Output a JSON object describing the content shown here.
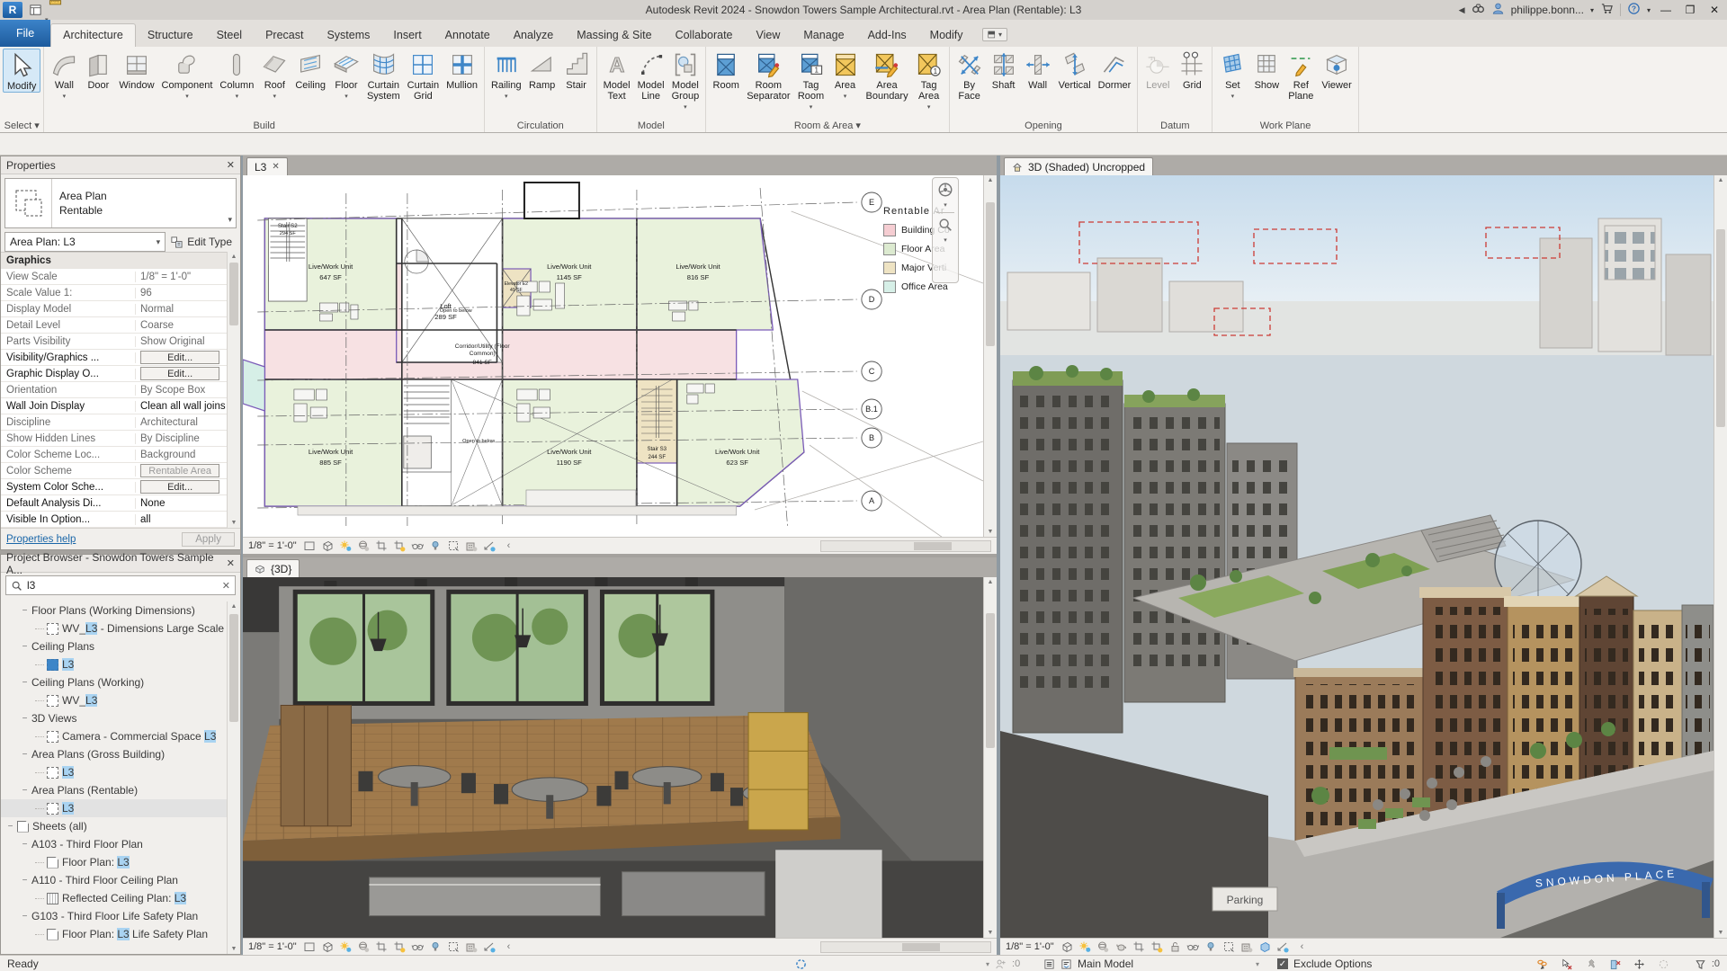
{
  "titlebar": {
    "title": "Autodesk Revit 2024 - Snowdon Towers Sample Architectural.rvt - Area Plan (Rentable): L3",
    "user": "philippe.bonn..."
  },
  "qat": [
    {
      "icon": "new-doc"
    },
    {
      "icon": "open-folder"
    },
    {
      "icon": "save"
    },
    {
      "icon": "sync",
      "arrow": true
    },
    {
      "icon": "undo",
      "arrow": true
    },
    {
      "icon": "redo",
      "arrow": true
    },
    {
      "icon": "print"
    },
    {
      "icon": "print-setup"
    },
    {
      "sep": true
    },
    {
      "icon": "modify-pin"
    },
    {
      "icon": "measure",
      "arrow": true
    },
    {
      "icon": "aligned-dimension"
    },
    {
      "icon": "tag-by-category"
    },
    {
      "icon": "text"
    },
    {
      "sep": true
    },
    {
      "icon": "default-3d-view",
      "arrow": true
    },
    {
      "icon": "view-marker"
    },
    {
      "icon": "thin-lines"
    },
    {
      "sep": true
    },
    {
      "icon": "copy"
    },
    {
      "icon": "switch-windows",
      "arrow": true
    },
    {
      "icon": "customize-qat"
    }
  ],
  "tabs": {
    "items": [
      "File",
      "Architecture",
      "Structure",
      "Steel",
      "Precast",
      "Systems",
      "Insert",
      "Annotate",
      "Analyze",
      "Massing & Site",
      "Collaborate",
      "View",
      "Manage",
      "Add-Ins",
      "Modify"
    ],
    "active": "Architecture"
  },
  "ribbon": {
    "panels": [
      {
        "label": "Select ▾",
        "buttons": [
          {
            "label": "Modify",
            "icon": "modify",
            "selected": true
          }
        ]
      },
      {
        "label": "Build",
        "buttons": [
          {
            "label": "Wall",
            "icon": "wall",
            "arrow": true
          },
          {
            "label": "Door",
            "icon": "door"
          },
          {
            "label": "Window",
            "icon": "window"
          },
          {
            "label": "Component",
            "icon": "component",
            "arrow": true
          },
          {
            "label": "Column",
            "icon": "column",
            "arrow": true
          },
          {
            "label": "Roof",
            "icon": "roof",
            "arrow": true
          },
          {
            "label": "Ceiling",
            "icon": "ceiling"
          },
          {
            "label": "Floor",
            "icon": "floor",
            "arrow": true
          },
          {
            "label": "Curtain\nSystem",
            "icon": "curtain-system"
          },
          {
            "label": "Curtain\nGrid",
            "icon": "curtain-grid"
          },
          {
            "label": "Mullion",
            "icon": "mullion"
          }
        ]
      },
      {
        "label": "Circulation",
        "buttons": [
          {
            "label": "Railing",
            "icon": "railing",
            "arrow": true
          },
          {
            "label": "Ramp",
            "icon": "ramp"
          },
          {
            "label": "Stair",
            "icon": "stair"
          }
        ]
      },
      {
        "label": "Model",
        "buttons": [
          {
            "label": "Model\nText",
            "icon": "model-text"
          },
          {
            "label": "Model\nLine",
            "icon": "model-line"
          },
          {
            "label": "Model\nGroup",
            "icon": "model-group",
            "arrow": true
          }
        ]
      },
      {
        "label": "Room & Area ▾",
        "buttons": [
          {
            "label": "Room",
            "icon": "room"
          },
          {
            "label": "Room\nSeparator",
            "icon": "room-separator"
          },
          {
            "label": "Tag\nRoom",
            "icon": "tag-room",
            "arrow": true
          },
          {
            "label": "Area",
            "icon": "area",
            "arrow": true
          },
          {
            "label": "Area\nBoundary",
            "icon": "area-boundary"
          },
          {
            "label": "Tag\nArea",
            "icon": "tag-area",
            "arrow": true
          }
        ]
      },
      {
        "label": "Opening",
        "buttons": [
          {
            "label": "By\nFace",
            "icon": "by-face"
          },
          {
            "label": "Shaft",
            "icon": "shaft"
          },
          {
            "label": "Wall",
            "icon": "wall-opening"
          },
          {
            "label": "Vertical",
            "icon": "vertical-opening"
          },
          {
            "label": "Dormer",
            "icon": "dormer"
          }
        ]
      },
      {
        "label": "Datum",
        "buttons": [
          {
            "label": "Level",
            "icon": "level",
            "disabled": true
          },
          {
            "label": "Grid",
            "icon": "grid"
          }
        ]
      },
      {
        "label": "Work Plane",
        "buttons": [
          {
            "label": "Set",
            "icon": "set",
            "arrow": true
          },
          {
            "label": "Show",
            "icon": "show"
          },
          {
            "label": "Ref\nPlane",
            "icon": "ref-plane"
          },
          {
            "label": "Viewer",
            "icon": "viewer"
          }
        ]
      }
    ]
  },
  "properties": {
    "header": "Properties",
    "type_name": "Area Plan",
    "type_family": "Rentable",
    "selector": "Area Plan: L3",
    "edit_type": "Edit Type",
    "group": "Graphics",
    "rows": [
      {
        "name": "View Scale",
        "value": "1/8\" = 1'-0\""
      },
      {
        "name": "Scale Value    1:",
        "value": "96"
      },
      {
        "name": "Display Model",
        "value": "Normal"
      },
      {
        "name": "Detail Level",
        "value": "Coarse"
      },
      {
        "name": "Parts Visibility",
        "value": "Show Original"
      },
      {
        "name": "Visibility/Graphics ...",
        "value": "Edit...",
        "button": true,
        "editable": true
      },
      {
        "name": "Graphic Display O...",
        "value": "Edit...",
        "button": true,
        "editable": true
      },
      {
        "name": "Orientation",
        "value": "By Scope Box"
      },
      {
        "name": "Wall Join Display",
        "value": "Clean all wall joins",
        "editable": true
      },
      {
        "name": "Discipline",
        "value": "Architectural"
      },
      {
        "name": "Show Hidden Lines",
        "value": "By Discipline"
      },
      {
        "name": "Color Scheme Loc...",
        "value": "Background"
      },
      {
        "name": "Color Scheme",
        "value": "Rentable Area",
        "button": true,
        "gray": true
      },
      {
        "name": "System Color Sche...",
        "value": "Edit...",
        "button": true,
        "editable": true
      },
      {
        "name": "Default Analysis Di...",
        "value": "None",
        "editable": true
      },
      {
        "name": "Visible In Option...",
        "value": "all",
        "editable": true
      }
    ],
    "help": "Properties help",
    "apply": "Apply"
  },
  "browser": {
    "title": "Project Browser - Snowdon Towers Sample A...",
    "search": "l3",
    "items": [
      {
        "t": "cat",
        "d": 1,
        "label": "Floor Plans (Working Dimensions)"
      },
      {
        "t": "view",
        "d": 2,
        "icon": "plan",
        "pre": "WV_",
        "hl": "L3",
        "post": " - Dimensions Large Scale"
      },
      {
        "t": "cat",
        "d": 1,
        "label": "Ceiling Plans"
      },
      {
        "t": "view",
        "d": 2,
        "icon": "planblue",
        "pre": "",
        "hl": "L3",
        "post": ""
      },
      {
        "t": "cat",
        "d": 1,
        "label": "Ceiling Plans (Working)"
      },
      {
        "t": "view",
        "d": 2,
        "icon": "plan",
        "pre": "WV_",
        "hl": "L3",
        "post": ""
      },
      {
        "t": "cat",
        "d": 1,
        "label": "3D Views"
      },
      {
        "t": "view",
        "d": 2,
        "icon": "plan",
        "pre": "Camera - Commercial Space ",
        "hl": "L3",
        "post": ""
      },
      {
        "t": "cat",
        "d": 1,
        "label": "Area Plans (Gross Building)"
      },
      {
        "t": "view",
        "d": 2,
        "icon": "plan",
        "pre": "",
        "hl": "L3",
        "post": ""
      },
      {
        "t": "cat",
        "d": 1,
        "label": "Area Plans (Rentable)"
      },
      {
        "t": "view",
        "d": 2,
        "icon": "plan",
        "pre": "",
        "hl": "L3",
        "post": "",
        "selected": true
      },
      {
        "t": "cat",
        "d": 0,
        "icon": "sheet",
        "label": "Sheets (all)"
      },
      {
        "t": "cat",
        "d": 1,
        "label": "A103 - Third Floor Plan"
      },
      {
        "t": "view",
        "d": 2,
        "icon": "sheet",
        "pre": "Floor Plan: ",
        "hl": "L3",
        "post": ""
      },
      {
        "t": "cat",
        "d": 1,
        "label": "A110 - Third Floor Ceiling Plan"
      },
      {
        "t": "view",
        "d": 2,
        "icon": "rcp",
        "pre": "Reflected Ceiling Plan: ",
        "hl": "L3",
        "post": ""
      },
      {
        "t": "cat",
        "d": 1,
        "label": "G103 - Third Floor Life Safety Plan"
      },
      {
        "t": "view",
        "d": 2,
        "icon": "sheet",
        "pre": "Floor Plan: ",
        "hl": "L3",
        "post": " Life Safety Plan"
      }
    ]
  },
  "plan": {
    "tab": "L3",
    "scale": "1/8\" = 1'-0\"",
    "legend_title": "Rentable Ar",
    "legend": [
      {
        "label": "Building Co",
        "color": "#f5cdd2"
      },
      {
        "label": "Floor Area",
        "color": "#dcead0"
      },
      {
        "label": "Major Verti",
        "color": "#eee3c3"
      },
      {
        "label": "Office Area",
        "color": "#d6efe7"
      }
    ],
    "grids": [
      "E",
      "D",
      "C",
      "B.1",
      "B",
      "A"
    ],
    "open_below": "Open to below",
    "rooms": {
      "stair_s2": {
        "name": "Stair S2",
        "area": "294 SF"
      },
      "unit_647": {
        "name": "Live/Work Unit",
        "area": "647 SF"
      },
      "unit_1145": {
        "name": "Live/Work Unit",
        "area": "1145 SF"
      },
      "unit_816": {
        "name": "Live/Work Unit",
        "area": "816 SF"
      },
      "loft": {
        "name": "Loft",
        "area": "289 SF"
      },
      "elevator": {
        "name": "Elevator E2",
        "area": "49 SF"
      },
      "unit_885": {
        "name": "Live/Work Unit",
        "area": "885 SF"
      },
      "unit_1190": {
        "name": "Live/Work Unit",
        "area": "1190 SF"
      },
      "stair_s3": {
        "name": "Stair S3",
        "area": "244 SF"
      },
      "unit_623": {
        "name": "Live/Work Unit",
        "area": "623 SF"
      }
    },
    "corridor": {
      "name1": "Corridor/Utility (Floor",
      "name2": "Common)",
      "area": "841 SF"
    },
    "controls": [
      "crop-box",
      "visual-style",
      "sun-settings",
      "shadows-toggle",
      "crop-view",
      "crop-region",
      "reveal-hidden",
      "temporary-hide",
      "selection-box",
      "worksharing-display",
      "displace-elements"
    ]
  },
  "camera": {
    "tab": "{3D}",
    "scale": "1/8\" = 1'-0\"",
    "controls": [
      "crop-box",
      "visual-style",
      "sun-settings",
      "shadows-toggle",
      "crop-view",
      "crop-region",
      "reveal-hidden",
      "temporary-hide",
      "selection-box",
      "worksharing-display",
      "displace-elements"
    ]
  },
  "shaded": {
    "tab": "3D (Shaded) Uncropped",
    "scale": "1/8\" = 1'-0\"",
    "arch_text": "SNOWDON PLACE",
    "parking": "Parking",
    "controls": [
      "visual-style",
      "sun-settings",
      "shadows-toggle",
      "render-teapot",
      "crop-view",
      "crop-region",
      "unlock-view",
      "reveal-hidden",
      "temporary-hide",
      "selection-box",
      "worksharing-display",
      "cube-view",
      "displace-elements"
    ]
  },
  "statusbar": {
    "ready": "Ready",
    "worksets_count": ":0",
    "main_model": "Main Model",
    "exclude": "Exclude Options",
    "filter_count": ":0",
    "icons_right": [
      "chain-select",
      "cursor-unselect",
      "pin-cursor",
      "door-unselect",
      "move-cursor",
      "dashed-circle"
    ]
  }
}
